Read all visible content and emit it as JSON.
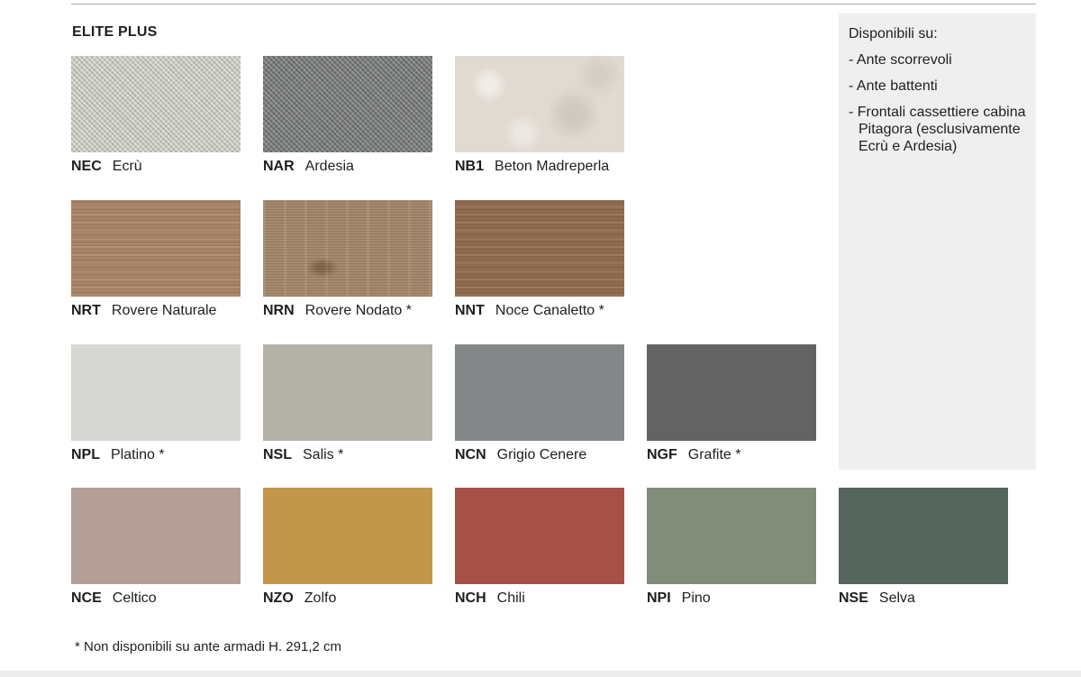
{
  "section": {
    "title": "ELITE PLUS"
  },
  "swatches": [
    {
      "code": "NEC",
      "name": "Ecrù",
      "color": "#c5c4bb",
      "texture": "herringbone-fabric"
    },
    {
      "code": "NAR",
      "name": "Ardesia",
      "color": "#7b7e7c",
      "texture": "herringbone-fabric"
    },
    {
      "code": "NB1",
      "name": "Beton Madreperla",
      "color": "#e0dad1",
      "texture": "concrete"
    },
    {
      "code": "NRT",
      "name": "Rovere Naturale",
      "color": "#a98366",
      "texture": "wood"
    },
    {
      "code": "NRN",
      "name": "Rovere Nodato *",
      "color": "#a68a70",
      "texture": "knotted-wood"
    },
    {
      "code": "NNT",
      "name": "Noce Canaletto *",
      "color": "#8e6b4f",
      "texture": "wood"
    },
    {
      "code": "NPL",
      "name": "Platino *",
      "color": "#d6d7d3",
      "texture": "solid"
    },
    {
      "code": "NSL",
      "name": "Salis *",
      "color": "#b4b2a7",
      "texture": "solid"
    },
    {
      "code": "NCN",
      "name": "Grigio Cenere",
      "color": "#838787",
      "texture": "solid"
    },
    {
      "code": "NGF",
      "name": "Grafite *",
      "color": "#636363",
      "texture": "solid"
    },
    {
      "code": "NCE",
      "name": "Celtico",
      "color": "#b59e97",
      "texture": "solid"
    },
    {
      "code": "NZO",
      "name": "Zolfo",
      "color": "#c19849",
      "texture": "solid"
    },
    {
      "code": "NCH",
      "name": "Chili",
      "color": "#a55145",
      "texture": "solid"
    },
    {
      "code": "NPI",
      "name": "Pino",
      "color": "#838b7a",
      "texture": "solid"
    },
    {
      "code": "NSE",
      "name": "Selva",
      "color": "#56655e",
      "texture": "solid"
    }
  ],
  "availability": {
    "heading": "Disponibili su:",
    "items": [
      "- Ante scorrevoli",
      "- Ante battenti",
      "- Frontali cassettiere cabina Pitagora (esclusivamente Ecrù e Ardesia)"
    ]
  },
  "footnote": "* Non disponibili su ante armadi H. 291,2 cm"
}
